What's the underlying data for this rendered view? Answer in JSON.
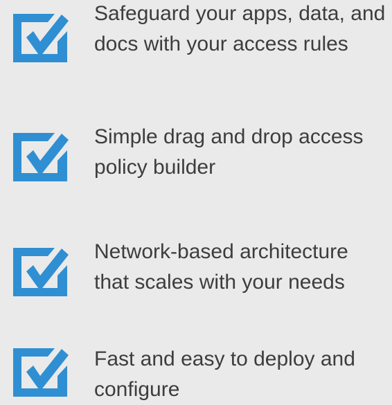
{
  "colors": {
    "background": "#eaeaea",
    "icon_blue": "#2f8fd2",
    "text": "#3d3d3d"
  },
  "features": [
    {
      "icon": "checkbox-checked-icon",
      "text": "Safeguard your apps, data, and docs with your access rules"
    },
    {
      "icon": "checkbox-checked-icon",
      "text": "Simple drag and drop access policy builder"
    },
    {
      "icon": "checkbox-checked-icon",
      "text": "Network-based architecture that scales with your needs"
    },
    {
      "icon": "checkbox-checked-icon",
      "text": "Fast and easy to deploy and configure"
    }
  ]
}
